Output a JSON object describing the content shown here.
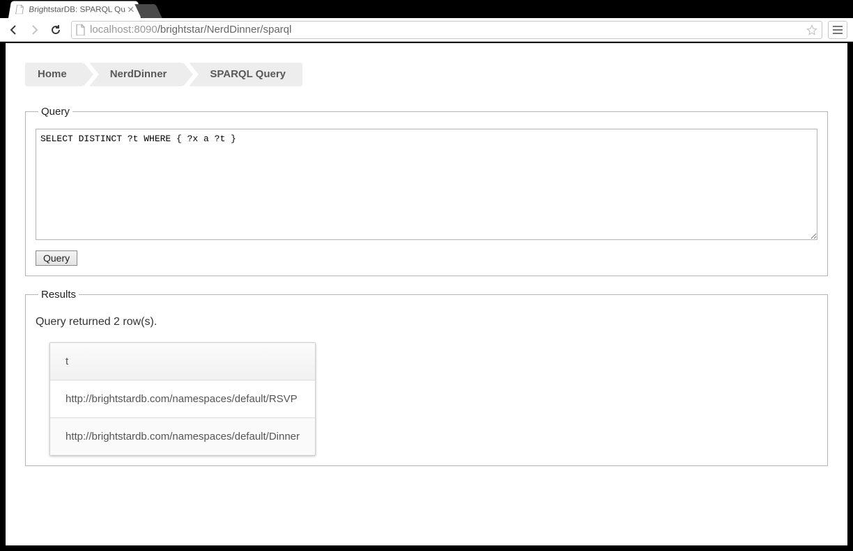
{
  "browser": {
    "tab_title": "BrightstarDB: SPARQL Que",
    "url_host": "localhost",
    "url_port": ":8090",
    "url_path": "/brightstar/NerdDinner/sparql"
  },
  "breadcrumb": {
    "items": [
      "Home",
      "NerdDinner",
      "SPARQL Query"
    ]
  },
  "query_section": {
    "legend": "Query",
    "query_text": "SELECT DISTINCT ?t WHERE { ?x a ?t }",
    "button_label": "Query"
  },
  "results_section": {
    "legend": "Results",
    "message": "Query returned 2 row(s).",
    "columns": [
      "t"
    ],
    "rows": [
      [
        "http://brightstardb.com/namespaces/default/RSVP"
      ],
      [
        "http://brightstardb.com/namespaces/default/Dinner"
      ]
    ]
  }
}
